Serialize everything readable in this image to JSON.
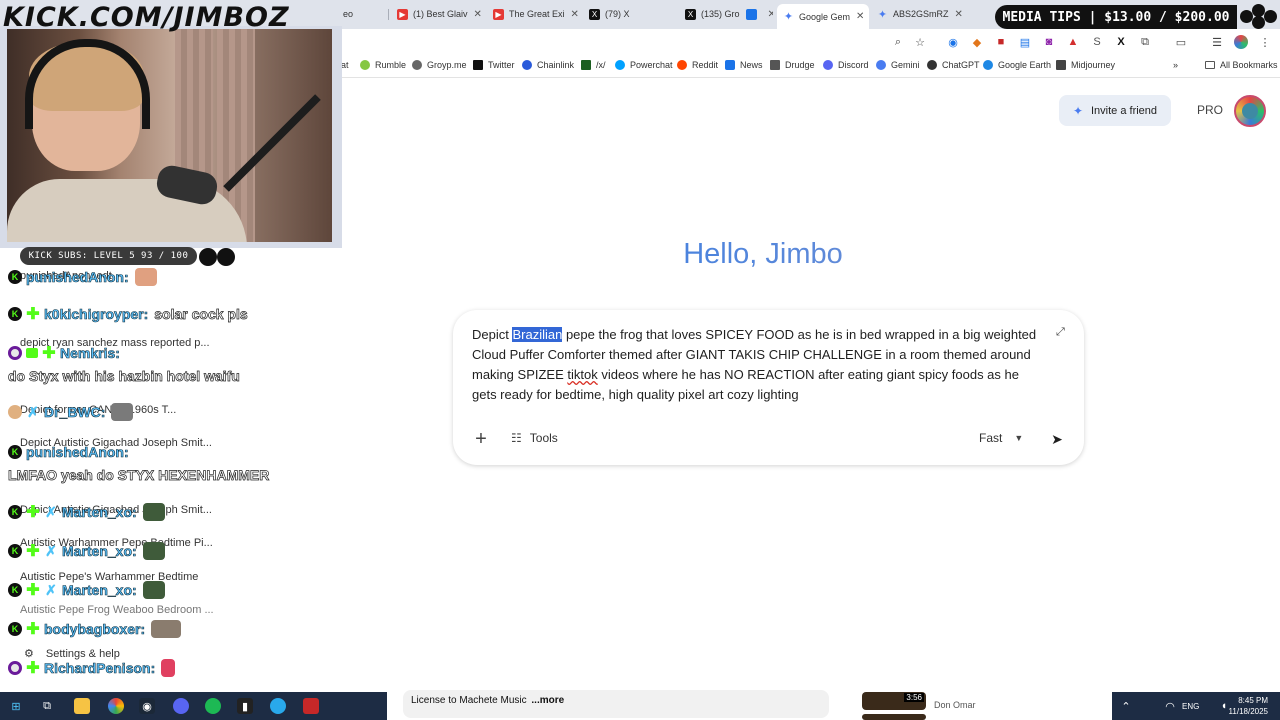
{
  "tabs": [
    {
      "label": "(1) Best Glaiv",
      "fav_color": "#e53935",
      "fav": "▶"
    },
    {
      "label": "The Great Exi",
      "fav_color": "#e53935",
      "fav": "▶"
    },
    {
      "label": "(79) X",
      "fav_color": "#111111",
      "fav": "X"
    },
    {
      "label": "(135) Gro",
      "fav_color": "#111111",
      "fav": "X"
    },
    {
      "label": "Google Gem",
      "fav_color": "#4a7cf0",
      "fav": "✦",
      "active": true
    },
    {
      "label": "ABS2GSmRZ",
      "fav_color": "#4a7cf0",
      "fav": "✦"
    }
  ],
  "tab_partial": "eo",
  "bookmarks": [
    {
      "label": "Rumble",
      "color": "#85c742"
    },
    {
      "label": "Groyp.me",
      "color": "#666666"
    },
    {
      "label": "Twitter",
      "color": "#111111"
    },
    {
      "label": "Chainlink",
      "color": "#2a5ada"
    },
    {
      "label": "/x/",
      "color": "#1b5e20"
    },
    {
      "label": "Powerchat",
      "color": "#00a1ff"
    },
    {
      "label": "Reddit",
      "color": "#ff4500"
    },
    {
      "label": "News",
      "color": "#1a73e8"
    },
    {
      "label": "Drudge",
      "color": "#555555"
    },
    {
      "label": "Discord",
      "color": "#5865f2"
    },
    {
      "label": "Gemini",
      "color": "#4a7cf0"
    },
    {
      "label": "ChatGPT",
      "color": "#333333"
    },
    {
      "label": "Google Earth",
      "color": "#1e88e5"
    },
    {
      "label": "Midjourney",
      "color": "#444444"
    }
  ],
  "bookmark_partial": "at",
  "all_bookmarks": "All Bookmarks",
  "header": {
    "invite": "Invite a friend",
    "pro": "PRO"
  },
  "greeting": "Hello, Jimbo",
  "prompt": {
    "before_sel": "Depict ",
    "selected": "Brazilian",
    "after_sel_1": " pepe the frog that loves SPICEY FOOD as he is in bed wrapped in a big weighted Cloud Puffer Comforter themed after GIANT TAKIS CHIP CHALLENGE in a room themed around making SPIZEE ",
    "misspelled": "tiktok",
    "after_sel_2": " videos where he has NO REACTION after eating giant spicy foods as he gets ready for bedtime, high quality pixel art cozy lighting",
    "tools": "Tools",
    "mode": "Fast"
  },
  "sidebar_ghosts": [
    "punishedAnon: edt",
    "depict ryan sanchez mass reported p...",
    "Depict former CAN W 1960s T...",
    "Depict Autistic Gigachad Joseph Smit...",
    "Depict Autistic Gigachad Joseph Smit...",
    "Autistic Warhammer Pepe Bedtime Pi...",
    "Autistic Pepe's Warhammer Bedtime",
    "Autistic Pepe Frog Weaboo Bedroom ...",
    "Settings & help"
  ],
  "overlay": {
    "kick_subs": "KICK SUBS: LEVEL 5 93 / 100",
    "watermark": "KICK.COM/JIMBOZ",
    "media_tips": "MEDIA TIPS | $13.00 / $200.00"
  },
  "chat": [
    {
      "user": "punishedAnon:",
      "msg": ""
    },
    {
      "user": "k0kichigroyper:",
      "msg": "solar cock pls"
    },
    {
      "user": "Nemkris:",
      "msg": "do Styx with his hazbin hotel waifu"
    },
    {
      "user": "Dr_BWC:",
      "msg": ""
    },
    {
      "user": "punishedAnon:",
      "msg": "LMFAO yeah do STYX HEXENHAMMER"
    },
    {
      "user": "Marten_xo:",
      "msg": ""
    },
    {
      "user": "Marten_xo:",
      "msg": ""
    },
    {
      "user": "Marten_xo:",
      "msg": ""
    },
    {
      "user": "bodybagboxer:",
      "msg": ""
    },
    {
      "user": "RichardPenison:",
      "msg": ""
    }
  ],
  "youtube": {
    "desc": "License to Machete Music",
    "more": "...more",
    "thumb_time": "3:56",
    "channel": "Don Omar"
  },
  "taskbar": {
    "lang": "ENG",
    "time": "8:45 PM",
    "date": "11/18/2025"
  }
}
